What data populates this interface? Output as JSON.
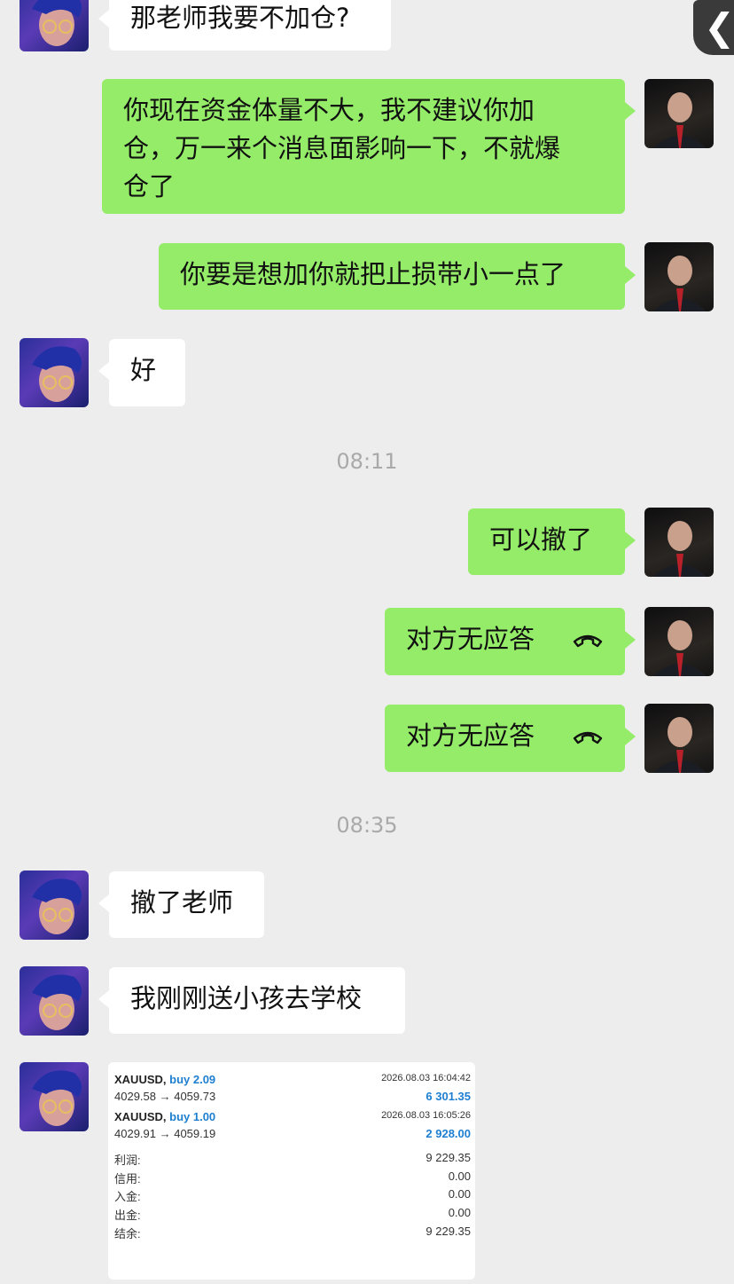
{
  "nav": {
    "back_glyph": "❮"
  },
  "timestamps": [
    "08:11",
    "08:35"
  ],
  "messages": {
    "m1": "那老师我要不加仓?",
    "m2_l1": "你现在资金体量不大，我不建议你加",
    "m2_l2": "仓，万一来个消息面影响一下，不就爆",
    "m2_l3": "仓了",
    "m3": "你要是想加你就把止损带小一点了",
    "m4": "好",
    "m5": "可以撤了",
    "m6": "对方无应答",
    "m7": "对方无应答",
    "m8": "撤了老师",
    "m9": "我刚刚送小孩去学校"
  },
  "trade_card": {
    "trades": [
      {
        "symbol": "XAUUSD,",
        "side": "buy 2.09",
        "time": "2026.08.03 16:04:42",
        "prices": "4029.58 → 4059.73",
        "profit": "6 301.35"
      },
      {
        "symbol": "XAUUSD,",
        "side": "buy 1.00",
        "time": "2026.08.03 16:05:26",
        "prices": "4029.91 → 4059.19",
        "profit": "2 928.00"
      }
    ],
    "summary": [
      {
        "label": "利润:",
        "value": "9 229.35"
      },
      {
        "label": "信用:",
        "value": "0.00"
      },
      {
        "label": "入金:",
        "value": "0.00"
      },
      {
        "label": "出金:",
        "value": "0.00"
      },
      {
        "label": "结余:",
        "value": "9 229.35"
      }
    ]
  },
  "colors": {
    "background": "#ededed",
    "sent_bubble": "#95ec69",
    "received_bubble": "#ffffff",
    "accent_blue": "#1e7fd0"
  }
}
